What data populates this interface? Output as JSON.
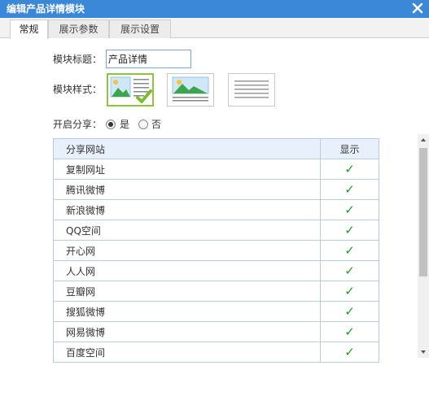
{
  "window": {
    "title": "编辑产品详情模块",
    "close_icon": "close-icon"
  },
  "tabs": [
    {
      "label": "常规",
      "active": true
    },
    {
      "label": "展示参数",
      "active": false
    },
    {
      "label": "展示设置",
      "active": false
    }
  ],
  "form": {
    "module_title_label": "模块标题：",
    "module_title_value": "产品详情",
    "module_style_label": "模块样式：",
    "style_options": [
      {
        "icon": "image-left-text-right-icon",
        "selected": true
      },
      {
        "icon": "image-top-text-bottom-icon",
        "selected": false
      },
      {
        "icon": "text-only-icon",
        "selected": false
      }
    ],
    "share_label": "开启分享：",
    "share_yes": "是",
    "share_no": "否",
    "share_enabled": true
  },
  "share_table": {
    "headers": [
      "分享网站",
      "显示"
    ],
    "rows": [
      {
        "site": "复制网址",
        "show": "✓"
      },
      {
        "site": "腾讯微博",
        "show": "✓"
      },
      {
        "site": "新浪微博",
        "show": "✓"
      },
      {
        "site": "QQ空间",
        "show": "✓"
      },
      {
        "site": "开心网",
        "show": "✓"
      },
      {
        "site": "人人网",
        "show": "✓"
      },
      {
        "site": "豆瓣网",
        "show": "✓"
      },
      {
        "site": "搜狐微博",
        "show": "✓"
      },
      {
        "site": "网易微博",
        "show": "✓"
      },
      {
        "site": "百度空间",
        "show": "✓"
      }
    ]
  },
  "colors": {
    "titlebar": "#3b88d8",
    "selected_border": "#8cc63e",
    "check": "#1f9e1f",
    "table_border": "#b8cde4"
  }
}
